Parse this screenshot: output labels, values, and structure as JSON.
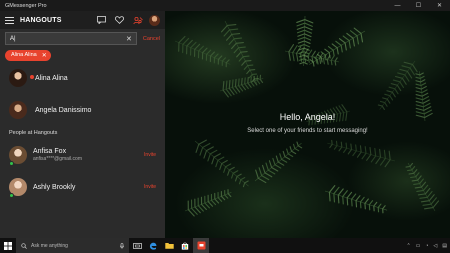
{
  "window": {
    "title": "GMessenger Pro",
    "minimize": "—",
    "maximize": "☐",
    "close": "✕"
  },
  "header": {
    "app_name": "HANGOUTS"
  },
  "search": {
    "value": "A|",
    "clear": "✕",
    "cancel": "Cancel"
  },
  "chips": [
    {
      "label": "Alina Alina",
      "remove": "✕"
    }
  ],
  "contacts": [
    {
      "name": "Alina Alina"
    },
    {
      "name": "Angela Danissimo"
    }
  ],
  "people_section": {
    "title": "People at Hangouts",
    "people": [
      {
        "name": "Anfisa Fox",
        "email": "anfisa****@gmail.com",
        "action": "Invite"
      },
      {
        "name": "Ashly Brookly",
        "email": "",
        "action": "Invite"
      }
    ]
  },
  "main": {
    "greeting": "Hello, Angela!",
    "subtitle": "Select one of your friends to start messaging!"
  },
  "taskbar": {
    "search_placeholder": "Ask me anything"
  },
  "colors": {
    "accent": "#e8432e",
    "panel": "#2b2b2b",
    "online": "#33c24a"
  }
}
